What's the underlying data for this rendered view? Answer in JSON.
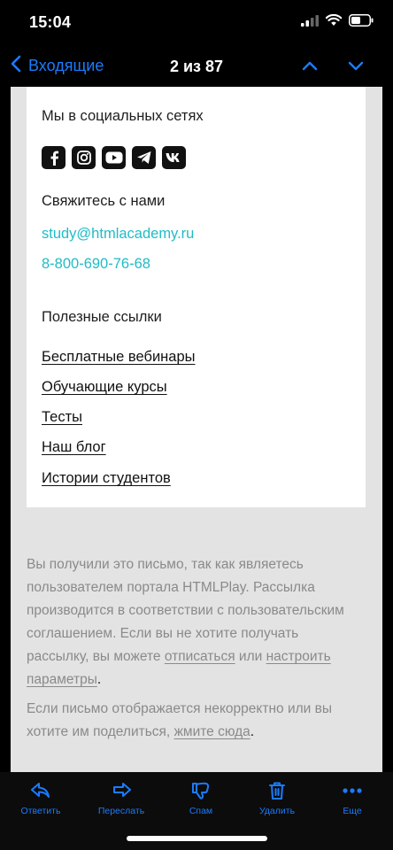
{
  "status": {
    "time": "15:04"
  },
  "nav": {
    "back_label": "Входящие",
    "counter": "2 из 87"
  },
  "card": {
    "social_title": "Мы в социальных сетях",
    "social_icons": [
      "facebook-icon",
      "instagram-icon",
      "youtube-icon",
      "telegram-icon",
      "vk-icon"
    ],
    "contact_title": "Свяжитесь с нами",
    "email": "study@htmlacademy.ru",
    "phone": "8-800-690-76-68",
    "links_title": "Полезные ссылки",
    "links": [
      "Бесплатные вебинары",
      "Обучающие курсы",
      "Тесты",
      "Наш блог",
      "Истории студентов"
    ]
  },
  "footer": {
    "para1_text": "Вы получили это письмо, так как являетесь пользователем портала HTMLPlay. Рассылка производится в соответствии с пользовательским соглашением. Если вы не хотите получать рассылку, вы можете",
    "unsubscribe_link": "отписаться",
    "or_word": "или",
    "settings_link": "настроить параметры",
    "para2_text": "Если письмо отображается некорректно или вы хотите им поделиться,",
    "here_link": "жмите сюда"
  },
  "toolbar": {
    "reply": "Ответить",
    "forward": "Переслать",
    "spam": "Спам",
    "delete": "Удалить",
    "more": "Еще"
  },
  "colors": {
    "accent": "#1a7cff",
    "teal_link": "#1fbcc6",
    "footer_bg": "#e3e3e3"
  }
}
